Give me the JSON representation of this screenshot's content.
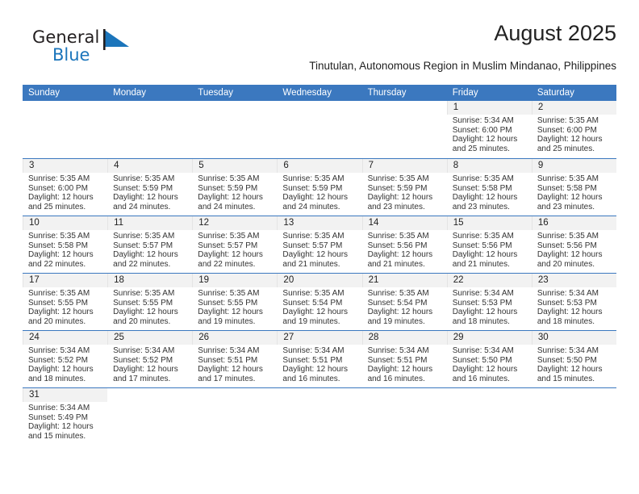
{
  "brand": {
    "name_part1": "General",
    "name_part2": "Blue",
    "flag_color": "#1b75bb"
  },
  "header": {
    "title": "August 2025",
    "subtitle": "Tinutulan, Autonomous Region in Muslim Mindanao, Philippines"
  },
  "theme": {
    "header_blue": "#3b78bf",
    "daynum_gray": "#f2f2f2",
    "text": "#222222"
  },
  "weekdays": [
    "Sunday",
    "Monday",
    "Tuesday",
    "Wednesday",
    "Thursday",
    "Friday",
    "Saturday"
  ],
  "weeks": [
    [
      {
        "day": "",
        "blank": true,
        "sunrise": "",
        "sunset": "",
        "daylight1": "",
        "daylight2": ""
      },
      {
        "day": "",
        "blank": true,
        "sunrise": "",
        "sunset": "",
        "daylight1": "",
        "daylight2": ""
      },
      {
        "day": "",
        "blank": true,
        "sunrise": "",
        "sunset": "",
        "daylight1": "",
        "daylight2": ""
      },
      {
        "day": "",
        "blank": true,
        "sunrise": "",
        "sunset": "",
        "daylight1": "",
        "daylight2": ""
      },
      {
        "day": "",
        "blank": true,
        "sunrise": "",
        "sunset": "",
        "daylight1": "",
        "daylight2": ""
      },
      {
        "day": "1",
        "blank": false,
        "sunrise": "Sunrise: 5:34 AM",
        "sunset": "Sunset: 6:00 PM",
        "daylight1": "Daylight: 12 hours",
        "daylight2": "and 25 minutes."
      },
      {
        "day": "2",
        "blank": false,
        "sunrise": "Sunrise: 5:35 AM",
        "sunset": "Sunset: 6:00 PM",
        "daylight1": "Daylight: 12 hours",
        "daylight2": "and 25 minutes."
      }
    ],
    [
      {
        "day": "3",
        "blank": false,
        "sunrise": "Sunrise: 5:35 AM",
        "sunset": "Sunset: 6:00 PM",
        "daylight1": "Daylight: 12 hours",
        "daylight2": "and 25 minutes."
      },
      {
        "day": "4",
        "blank": false,
        "sunrise": "Sunrise: 5:35 AM",
        "sunset": "Sunset: 5:59 PM",
        "daylight1": "Daylight: 12 hours",
        "daylight2": "and 24 minutes."
      },
      {
        "day": "5",
        "blank": false,
        "sunrise": "Sunrise: 5:35 AM",
        "sunset": "Sunset: 5:59 PM",
        "daylight1": "Daylight: 12 hours",
        "daylight2": "and 24 minutes."
      },
      {
        "day": "6",
        "blank": false,
        "sunrise": "Sunrise: 5:35 AM",
        "sunset": "Sunset: 5:59 PM",
        "daylight1": "Daylight: 12 hours",
        "daylight2": "and 24 minutes."
      },
      {
        "day": "7",
        "blank": false,
        "sunrise": "Sunrise: 5:35 AM",
        "sunset": "Sunset: 5:59 PM",
        "daylight1": "Daylight: 12 hours",
        "daylight2": "and 23 minutes."
      },
      {
        "day": "8",
        "blank": false,
        "sunrise": "Sunrise: 5:35 AM",
        "sunset": "Sunset: 5:58 PM",
        "daylight1": "Daylight: 12 hours",
        "daylight2": "and 23 minutes."
      },
      {
        "day": "9",
        "blank": false,
        "sunrise": "Sunrise: 5:35 AM",
        "sunset": "Sunset: 5:58 PM",
        "daylight1": "Daylight: 12 hours",
        "daylight2": "and 23 minutes."
      }
    ],
    [
      {
        "day": "10",
        "blank": false,
        "sunrise": "Sunrise: 5:35 AM",
        "sunset": "Sunset: 5:58 PM",
        "daylight1": "Daylight: 12 hours",
        "daylight2": "and 22 minutes."
      },
      {
        "day": "11",
        "blank": false,
        "sunrise": "Sunrise: 5:35 AM",
        "sunset": "Sunset: 5:57 PM",
        "daylight1": "Daylight: 12 hours",
        "daylight2": "and 22 minutes."
      },
      {
        "day": "12",
        "blank": false,
        "sunrise": "Sunrise: 5:35 AM",
        "sunset": "Sunset: 5:57 PM",
        "daylight1": "Daylight: 12 hours",
        "daylight2": "and 22 minutes."
      },
      {
        "day": "13",
        "blank": false,
        "sunrise": "Sunrise: 5:35 AM",
        "sunset": "Sunset: 5:57 PM",
        "daylight1": "Daylight: 12 hours",
        "daylight2": "and 21 minutes."
      },
      {
        "day": "14",
        "blank": false,
        "sunrise": "Sunrise: 5:35 AM",
        "sunset": "Sunset: 5:56 PM",
        "daylight1": "Daylight: 12 hours",
        "daylight2": "and 21 minutes."
      },
      {
        "day": "15",
        "blank": false,
        "sunrise": "Sunrise: 5:35 AM",
        "sunset": "Sunset: 5:56 PM",
        "daylight1": "Daylight: 12 hours",
        "daylight2": "and 21 minutes."
      },
      {
        "day": "16",
        "blank": false,
        "sunrise": "Sunrise: 5:35 AM",
        "sunset": "Sunset: 5:56 PM",
        "daylight1": "Daylight: 12 hours",
        "daylight2": "and 20 minutes."
      }
    ],
    [
      {
        "day": "17",
        "blank": false,
        "sunrise": "Sunrise: 5:35 AM",
        "sunset": "Sunset: 5:55 PM",
        "daylight1": "Daylight: 12 hours",
        "daylight2": "and 20 minutes."
      },
      {
        "day": "18",
        "blank": false,
        "sunrise": "Sunrise: 5:35 AM",
        "sunset": "Sunset: 5:55 PM",
        "daylight1": "Daylight: 12 hours",
        "daylight2": "and 20 minutes."
      },
      {
        "day": "19",
        "blank": false,
        "sunrise": "Sunrise: 5:35 AM",
        "sunset": "Sunset: 5:55 PM",
        "daylight1": "Daylight: 12 hours",
        "daylight2": "and 19 minutes."
      },
      {
        "day": "20",
        "blank": false,
        "sunrise": "Sunrise: 5:35 AM",
        "sunset": "Sunset: 5:54 PM",
        "daylight1": "Daylight: 12 hours",
        "daylight2": "and 19 minutes."
      },
      {
        "day": "21",
        "blank": false,
        "sunrise": "Sunrise: 5:35 AM",
        "sunset": "Sunset: 5:54 PM",
        "daylight1": "Daylight: 12 hours",
        "daylight2": "and 19 minutes."
      },
      {
        "day": "22",
        "blank": false,
        "sunrise": "Sunrise: 5:34 AM",
        "sunset": "Sunset: 5:53 PM",
        "daylight1": "Daylight: 12 hours",
        "daylight2": "and 18 minutes."
      },
      {
        "day": "23",
        "blank": false,
        "sunrise": "Sunrise: 5:34 AM",
        "sunset": "Sunset: 5:53 PM",
        "daylight1": "Daylight: 12 hours",
        "daylight2": "and 18 minutes."
      }
    ],
    [
      {
        "day": "24",
        "blank": false,
        "sunrise": "Sunrise: 5:34 AM",
        "sunset": "Sunset: 5:52 PM",
        "daylight1": "Daylight: 12 hours",
        "daylight2": "and 18 minutes."
      },
      {
        "day": "25",
        "blank": false,
        "sunrise": "Sunrise: 5:34 AM",
        "sunset": "Sunset: 5:52 PM",
        "daylight1": "Daylight: 12 hours",
        "daylight2": "and 17 minutes."
      },
      {
        "day": "26",
        "blank": false,
        "sunrise": "Sunrise: 5:34 AM",
        "sunset": "Sunset: 5:51 PM",
        "daylight1": "Daylight: 12 hours",
        "daylight2": "and 17 minutes."
      },
      {
        "day": "27",
        "blank": false,
        "sunrise": "Sunrise: 5:34 AM",
        "sunset": "Sunset: 5:51 PM",
        "daylight1": "Daylight: 12 hours",
        "daylight2": "and 16 minutes."
      },
      {
        "day": "28",
        "blank": false,
        "sunrise": "Sunrise: 5:34 AM",
        "sunset": "Sunset: 5:51 PM",
        "daylight1": "Daylight: 12 hours",
        "daylight2": "and 16 minutes."
      },
      {
        "day": "29",
        "blank": false,
        "sunrise": "Sunrise: 5:34 AM",
        "sunset": "Sunset: 5:50 PM",
        "daylight1": "Daylight: 12 hours",
        "daylight2": "and 16 minutes."
      },
      {
        "day": "30",
        "blank": false,
        "sunrise": "Sunrise: 5:34 AM",
        "sunset": "Sunset: 5:50 PM",
        "daylight1": "Daylight: 12 hours",
        "daylight2": "and 15 minutes."
      }
    ],
    [
      {
        "day": "31",
        "blank": false,
        "sunrise": "Sunrise: 5:34 AM",
        "sunset": "Sunset: 5:49 PM",
        "daylight1": "Daylight: 12 hours",
        "daylight2": "and 15 minutes."
      },
      {
        "day": "",
        "blank": true,
        "sunrise": "",
        "sunset": "",
        "daylight1": "",
        "daylight2": ""
      },
      {
        "day": "",
        "blank": true,
        "sunrise": "",
        "sunset": "",
        "daylight1": "",
        "daylight2": ""
      },
      {
        "day": "",
        "blank": true,
        "sunrise": "",
        "sunset": "",
        "daylight1": "",
        "daylight2": ""
      },
      {
        "day": "",
        "blank": true,
        "sunrise": "",
        "sunset": "",
        "daylight1": "",
        "daylight2": ""
      },
      {
        "day": "",
        "blank": true,
        "sunrise": "",
        "sunset": "",
        "daylight1": "",
        "daylight2": ""
      },
      {
        "day": "",
        "blank": true,
        "sunrise": "",
        "sunset": "",
        "daylight1": "",
        "daylight2": ""
      }
    ]
  ]
}
